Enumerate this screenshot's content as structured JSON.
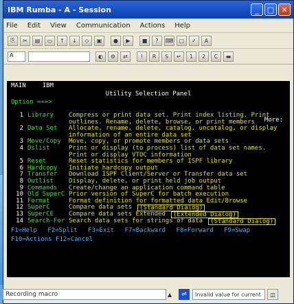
{
  "window": {
    "title": "IBM Rumba - A - Session"
  },
  "menu": [
    "File",
    "Edit",
    "View",
    "Communication",
    "Actions",
    "Help"
  ],
  "toolbar_icons": [
    "copy-icon",
    "cut-icon",
    "paste-icon",
    "print-icon",
    "send-icon",
    "receive-icon",
    "clear-icon",
    "macro-icon",
    "record-icon",
    "play-icon",
    "stop-icon",
    "help-icon",
    "keyboard-icon",
    "display-icon",
    "hotspot-icon",
    "font-icon",
    "color-icon",
    "settings-icon",
    "connect-icon"
  ],
  "session_bar": {
    "field1": "A",
    "field2": ""
  },
  "screen": {
    "header_left": "MAIN",
    "header_right": "IBM",
    "title": "Utility Selection Panel",
    "select_label": "Option ===>",
    "more": "More:",
    "options": [
      {
        "num": "1",
        "name": "Library",
        "desc": "Compress or print data set. Print index listing. Print",
        "tag": ""
      },
      {
        "num": "",
        "name": "",
        "desc": "  outlines. Rename, delete, browse, or print members",
        "tag": ""
      },
      {
        "num": "2",
        "name": "Data Set",
        "desc": "Allocate, rename, delete, catalog, uncatalog, or display",
        "tag": ""
      },
      {
        "num": "",
        "name": "",
        "desc": "  information of an entire data set",
        "tag": ""
      },
      {
        "num": "3",
        "name": "Move/Copy",
        "desc": "Move, copy, or promote members or data sets",
        "tag": ""
      },
      {
        "num": "4",
        "name": "Dslist",
        "desc": "Print or display (to process) list of data set names.",
        "tag": ""
      },
      {
        "num": "",
        "name": "",
        "desc": "  Print or display VTOC information",
        "tag": ""
      },
      {
        "num": "5",
        "name": "Reset",
        "desc": "Reset statistics for members of ISPF library",
        "tag": ""
      },
      {
        "num": "6",
        "name": "Hardcopy",
        "desc": "Initiate hardcopy output",
        "tag": ""
      },
      {
        "num": "7",
        "name": "Transfer",
        "desc": "Download ISPF Client/Server or Transfer data set",
        "tag": ""
      },
      {
        "num": "8",
        "name": "Outlist",
        "desc": "Display, delete, or print held job output",
        "tag": ""
      },
      {
        "num": "9",
        "name": "Commands",
        "desc": "Create/change an application command table",
        "tag": ""
      },
      {
        "num": "10",
        "name": "Old SuperC",
        "desc": "Prior version of SuperC for batch execution",
        "tag": ""
      },
      {
        "num": "11",
        "name": "Format",
        "desc": "Format definition for formatted data Edit/Browse",
        "tag": ""
      },
      {
        "num": "12",
        "name": "SuperC",
        "desc": "Compare data sets",
        "tag": "(Standard Dialog)"
      },
      {
        "num": "13",
        "name": "SuperCE",
        "desc": "Compare data sets Extended",
        "tag": "(Extended Dialog)"
      },
      {
        "num": "14",
        "name": "Search-For",
        "desc": "Search data sets for strings of data",
        "tag": "(Standard Dialog)"
      }
    ],
    "fkeys": [
      "F1=Help",
      "F2=Split",
      "F3=Exit",
      "F7=Backward",
      "F8=Forward",
      "F9=Swap"
    ],
    "fkeys2": "F10=Actions  F12=Cancel"
  },
  "status": {
    "left_text": "Recording macro",
    "right_text": "Invalid value for current"
  }
}
